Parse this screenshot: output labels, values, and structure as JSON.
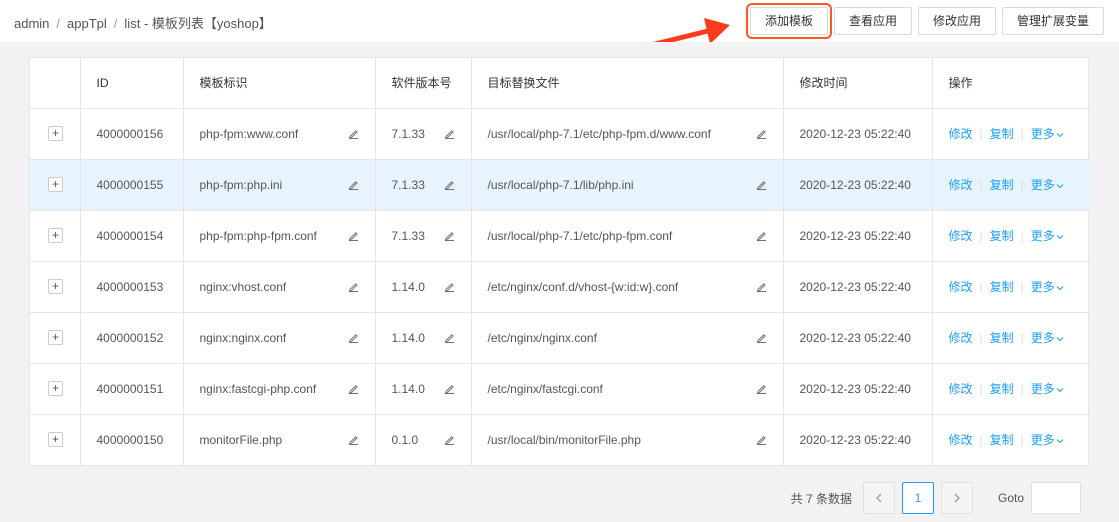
{
  "breadcrumb": [
    "admin",
    "appTpl",
    "list"
  ],
  "breadcrumb_separator": "/",
  "page_title_suffix": "-  模板列表【yoshop】",
  "toolbar": {
    "add_template": "添加模板",
    "view_app": "查看应用",
    "edit_app": "修改应用",
    "manage_vars": "管理扩展变量"
  },
  "table": {
    "columns": [
      "ID",
      "模板标识",
      "软件版本号",
      "目标替换文件",
      "修改时间",
      "操作"
    ],
    "rows": [
      {
        "id": "4000000156",
        "name": "php-fpm:www.conf",
        "version": "7.1.33",
        "file": "/usr/local/php-7.1/etc/php-fpm.d/www.conf",
        "time": "2020-12-23 05:22:40"
      },
      {
        "id": "4000000155",
        "name": "php-fpm:php.ini",
        "version": "7.1.33",
        "file": "/usr/local/php-7.1/lib/php.ini",
        "time": "2020-12-23 05:22:40"
      },
      {
        "id": "4000000154",
        "name": "php-fpm:php-fpm.conf",
        "version": "7.1.33",
        "file": "/usr/local/php-7.1/etc/php-fpm.conf",
        "time": "2020-12-23 05:22:40"
      },
      {
        "id": "4000000153",
        "name": "nginx:vhost.conf",
        "version": "1.14.0",
        "file": "/etc/nginx/conf.d/vhost-{w:id:w}.conf",
        "time": "2020-12-23 05:22:40"
      },
      {
        "id": "4000000152",
        "name": "nginx:nginx.conf",
        "version": "1.14.0",
        "file": "/etc/nginx/nginx.conf",
        "time": "2020-12-23 05:22:40"
      },
      {
        "id": "4000000151",
        "name": "nginx:fastcgi-php.conf",
        "version": "1.14.0",
        "file": "/etc/nginx/fastcgi.conf",
        "time": "2020-12-23 05:22:40"
      },
      {
        "id": "4000000150",
        "name": "monitorFile.php",
        "version": "0.1.0",
        "file": "/usr/local/bin/monitorFile.php",
        "time": "2020-12-23 05:22:40"
      }
    ],
    "expand_symbol": "+",
    "row_actions": {
      "edit": "修改",
      "copy": "复制",
      "more": "更多"
    },
    "action_separator": "|"
  },
  "pagination": {
    "total_text": "共 7 条数据",
    "current_page": "1",
    "goto_label": "Goto",
    "goto_value": ""
  },
  "colors": {
    "link": "#1e9fff",
    "highlight_row": "#e8f4fd",
    "annotation": "#ff3b1f"
  }
}
